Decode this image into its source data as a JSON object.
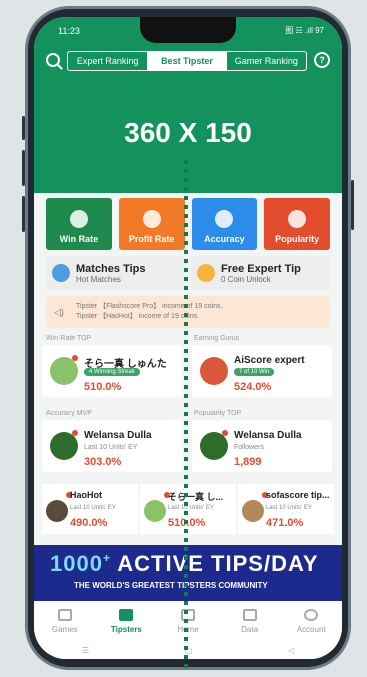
{
  "status": {
    "time": "11:23",
    "right": "图 ☵ .ıll 97"
  },
  "header": {
    "tabs": [
      "Expert Ranking",
      "Best Tipster",
      "Gamer Ranking"
    ],
    "active_tab": "Best Tipster",
    "banner": "360 X 150"
  },
  "categories": [
    {
      "label": "Win Rate",
      "color": "#1f8a4d"
    },
    {
      "label": "Profit Rate",
      "color": "#f07a25"
    },
    {
      "label": "Accuracy",
      "color": "#2d8bea"
    },
    {
      "label": "Popularity",
      "color": "#e34d2e"
    }
  ],
  "tips": [
    {
      "title": "Matches Tips",
      "sub": "Hot Matches"
    },
    {
      "title": "Free Expert Tip",
      "sub": "0 Coin Unlock"
    }
  ],
  "notice": {
    "line1": "Tipster  【Flashscore Pro】 income of 19 coins.",
    "line2": "Tipster  【HaoHot】 income of 19 coins."
  },
  "sections": {
    "winrate": "Win-Rate TOP",
    "earning": "Earning Gurus",
    "accuracy": "Accuracy MVP",
    "popularity": "Popularity TOP"
  },
  "cards": {
    "winrate": {
      "name": "そら一真 しゅんた",
      "badge": "4 Winning Streak",
      "value": "510.0%"
    },
    "earning": {
      "name": "AiScore expert",
      "badge": "7 of 10 Win",
      "value": "524.0%"
    },
    "accuracy": {
      "name": "Welansa Dulla",
      "sub": "Last 10 Units' EY",
      "value": "303.0%"
    },
    "popularity": {
      "name": "Welansa Dulla",
      "sub": "Followers",
      "value": "1,899"
    }
  },
  "mini_cards": [
    {
      "name": "HaoHot",
      "sub": "Last 10 Units' EY",
      "value": "490.0%"
    },
    {
      "name": "そら一真 し...",
      "sub": "Last 10 Units' EY",
      "value": "510.0%"
    },
    {
      "name": "sofascore tip...",
      "sub": "Last 10 Units' EY",
      "value": "471.0%"
    }
  ],
  "ad": {
    "big_prefix": "1000",
    "big_plus": "+",
    "big_rest": "ACTIVE TIPS/DAY",
    "small": "THE WORLD'S GREATEST TIPSTERS COMMUNITY"
  },
  "nav": [
    "Games",
    "Tipsters",
    "Home",
    "Data",
    "Account"
  ],
  "nav_active": "Tipsters",
  "sysbar": [
    "☰",
    "▢",
    "◁"
  ]
}
